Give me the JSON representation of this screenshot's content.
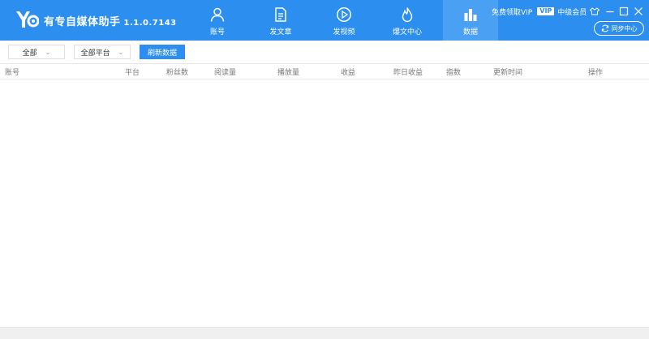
{
  "app": {
    "name": "有专自媒体助手",
    "version": "1.1.0.7143",
    "logo_text": "YO"
  },
  "nav": [
    {
      "label": "账号",
      "icon": "user-icon"
    },
    {
      "label": "发文章",
      "icon": "document-icon"
    },
    {
      "label": "发视频",
      "icon": "play-icon"
    },
    {
      "label": "爆文中心",
      "icon": "flame-icon"
    },
    {
      "label": "数据",
      "icon": "bar-chart-icon",
      "active": true
    }
  ],
  "vip": {
    "free_text": "免费领取VIP",
    "badge": "VIP",
    "level": "中级会员"
  },
  "sync_button": "同步中心",
  "filters": {
    "scope": "全部",
    "platform": "全部平台",
    "refresh_button": "刷新数据"
  },
  "table": {
    "columns": [
      "账号",
      "平台",
      "粉丝数",
      "阅读量",
      "播放量",
      "收益",
      "昨日收益",
      "指数",
      "更新时间",
      "操作"
    ],
    "rows": []
  },
  "colors": {
    "primary": "#2c8ff0",
    "active_tab": "#4aa1f3"
  }
}
